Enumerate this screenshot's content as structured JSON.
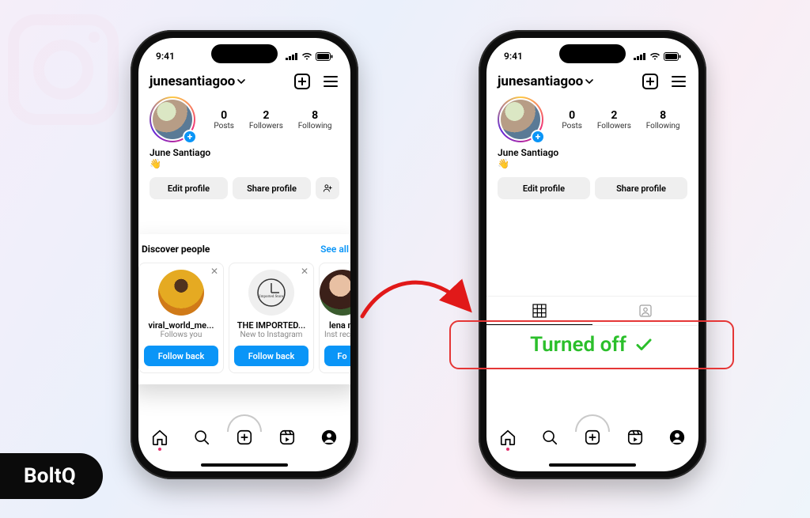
{
  "brand": "BoltQ",
  "statusbar": {
    "time": "9:41"
  },
  "header": {
    "username": "junesantiagoo"
  },
  "profile": {
    "display_name": "June Santiago",
    "bio_emoji": "👋",
    "stats": {
      "posts": {
        "count": "0",
        "label": "Posts"
      },
      "followers": {
        "count": "2",
        "label": "Followers"
      },
      "following": {
        "count": "8",
        "label": "Following"
      }
    }
  },
  "actions": {
    "edit_profile": "Edit profile",
    "share_profile": "Share profile"
  },
  "discover": {
    "title": "Discover people",
    "see_all": "See all",
    "cards": [
      {
        "name": "viral_world_me...",
        "sub": "Follows you",
        "cta": "Follow back"
      },
      {
        "name": "THE IMPORTED...",
        "sub": "New to Instagram",
        "cta": "Follow back"
      },
      {
        "name": "lena m",
        "sub": "Inst\nrecom",
        "cta": "Fo"
      }
    ]
  },
  "callout": {
    "text": "Turned off"
  }
}
